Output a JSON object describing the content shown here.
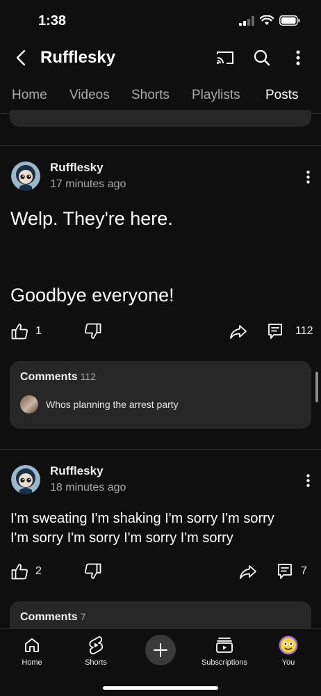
{
  "status": {
    "time": "1:38"
  },
  "header": {
    "title": "Rufflesky"
  },
  "tabs": [
    {
      "label": "Home"
    },
    {
      "label": "Videos"
    },
    {
      "label": "Shorts"
    },
    {
      "label": "Playlists"
    },
    {
      "label": "Posts"
    }
  ],
  "active_tab": "Posts",
  "posts": [
    {
      "author": "Rufflesky",
      "time": "17 minutes ago",
      "text_line1": "Welp. They're here.",
      "text_line2": "Goodbye everyone!",
      "likes": "1",
      "comment_count": "112",
      "comments_label": "Comments",
      "comments_total": "112",
      "top_comment": "Whos planning the arrest party"
    },
    {
      "author": "Rufflesky",
      "time": "18 minutes ago",
      "text_line1": "I'm sweating I'm shaking I'm sorry I'm sorry",
      "text_line2": "I'm sorry I'm sorry I'm sorry I'm sorry",
      "likes": "2",
      "comment_count": "7",
      "comments_label": "Comments",
      "comments_total": "7"
    }
  ],
  "bottom_nav": [
    {
      "label": "Home",
      "icon": "home-icon"
    },
    {
      "label": "Shorts",
      "icon": "shorts-icon"
    },
    {
      "label": "",
      "icon": "plus-icon"
    },
    {
      "label": "Subscriptions",
      "icon": "subscriptions-icon"
    },
    {
      "label": "You",
      "icon": "you-avatar"
    }
  ]
}
